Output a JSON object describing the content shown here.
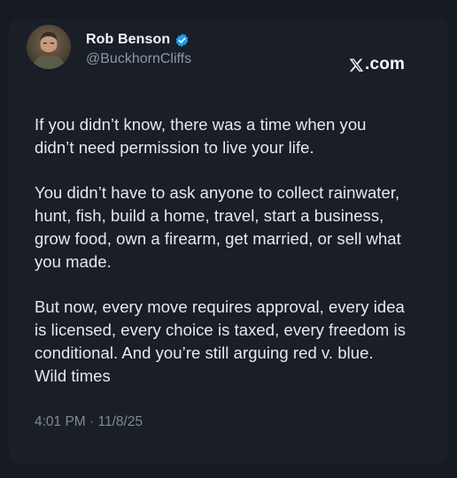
{
  "post": {
    "author": {
      "name": "Rob Benson",
      "handle": "@BuckhornCliffs",
      "verified": true,
      "avatar_icon": "profile-photo"
    },
    "brand": {
      "icon": "x-logo-icon",
      "text": ".com"
    },
    "paragraphs": [
      {
        "lines": [
          "If you didn’t know, there was a time when you",
          "didn’t need permission to live your life."
        ]
      },
      {
        "lines": [
          "You didn’t have to ask anyone to collect rainwater,",
          "hunt, fish, build a home, travel, start a business,",
          "grow food, own a firearm, get married, or sell what",
          "you made."
        ]
      },
      {
        "lines": [
          "But now, every move requires approval, every idea",
          "is licensed, every choice is taxed, every freedom is",
          "conditional. And you’re still arguing red v. blue.",
          "Wild times"
        ]
      }
    ],
    "timestamp": "4:01 PM · 11/8/25"
  },
  "colors": {
    "background": "#161a22",
    "text": "#e7e9ea",
    "secondary_text": "#8b98a5",
    "verified_badge": "#1d9bf0"
  }
}
